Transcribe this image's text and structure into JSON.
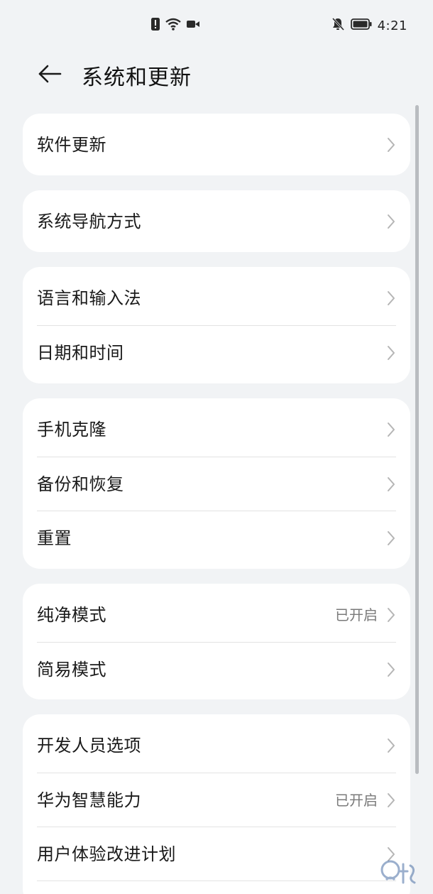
{
  "status_bar": {
    "time": "4:21",
    "center_icons": [
      "alert-icon",
      "wifi-icon",
      "video-record-icon"
    ],
    "right_icons": [
      "bell-muted-icon",
      "battery-icon"
    ]
  },
  "header": {
    "back_icon": "arrow-left-icon",
    "title": "系统和更新"
  },
  "groups": [
    {
      "items": [
        {
          "label": "软件更新"
        }
      ]
    },
    {
      "items": [
        {
          "label": "系统导航方式"
        }
      ]
    },
    {
      "items": [
        {
          "label": "语言和输入法"
        },
        {
          "label": "日期和时间"
        }
      ]
    },
    {
      "items": [
        {
          "label": "手机克隆"
        },
        {
          "label": "备份和恢复"
        },
        {
          "label": "重置"
        }
      ]
    },
    {
      "items": [
        {
          "label": "纯净模式",
          "value": "已开启"
        },
        {
          "label": "简易模式"
        }
      ]
    },
    {
      "items": [
        {
          "label": "开发人员选项"
        },
        {
          "label": "华为智慧能力",
          "value": "已开启"
        },
        {
          "label": "用户体验改进计划"
        }
      ]
    }
  ],
  "colors": {
    "background": "#f1f3f5",
    "card": "#ffffff",
    "text_primary": "#1a1a1a",
    "text_secondary": "#7a7a7a",
    "chevron": "#b5b5b5"
  }
}
